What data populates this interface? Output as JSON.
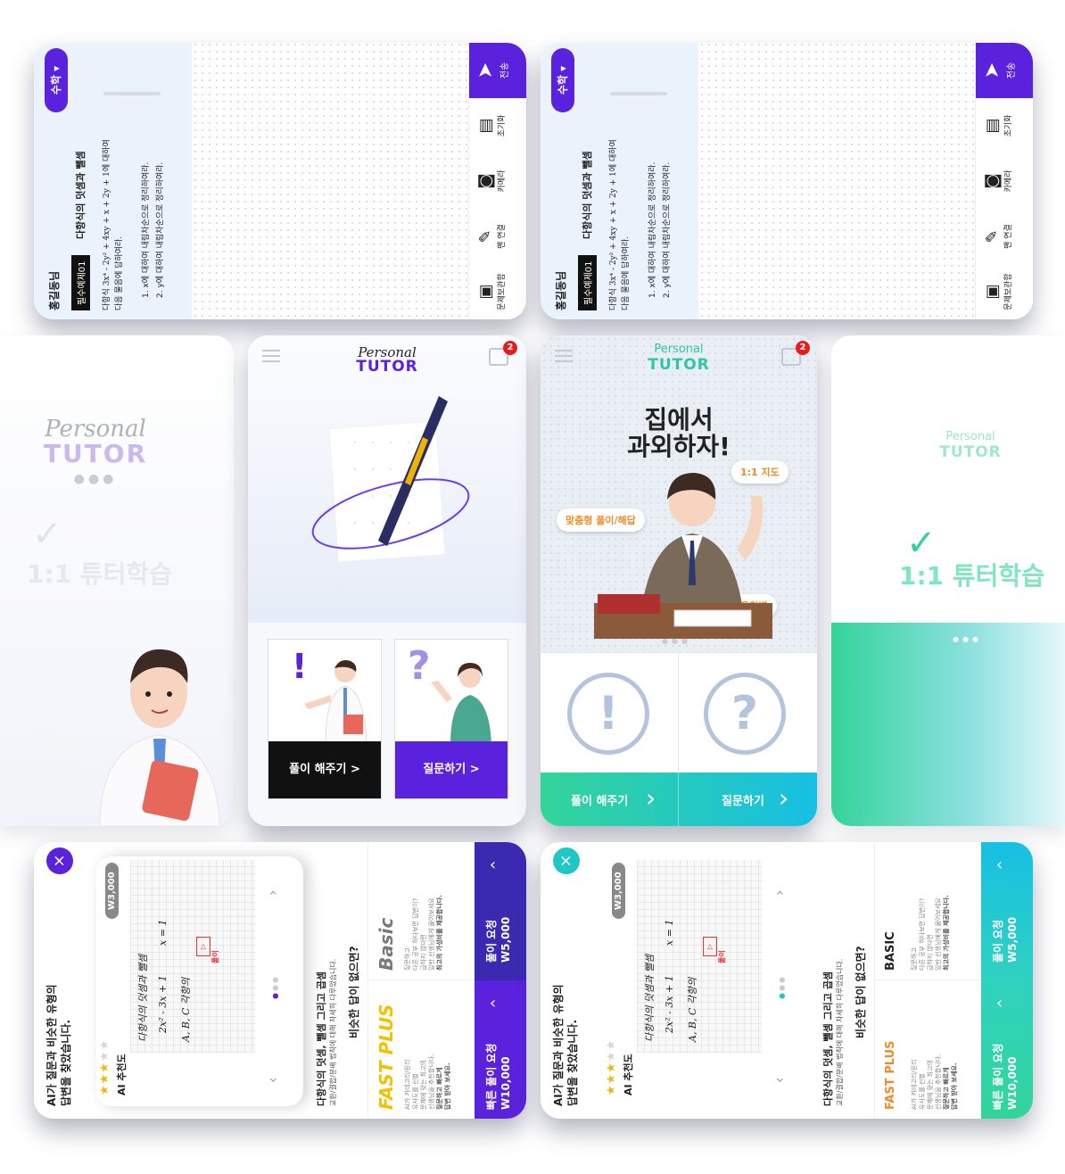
{
  "colors": {
    "purple": "#5a22dc",
    "teal": "#17bfe3",
    "green": "#33d49a",
    "navy": "#2a2d62",
    "orange": "#f0a030"
  },
  "problem_cards": {
    "user": "홍길동님",
    "subject": "수학",
    "badge": "필수예제01",
    "title": "다항식의 덧셈과 뺄셈",
    "line1": "다항식  3x⁴ - 2y² + 4xy + x + 2y + 1에 대하여",
    "line2": "다음 물음에 답하여라.",
    "q1": "1. x에 대하여 내림차순으로 정리하여라.",
    "q2": "2. y에 대하여 내림차순으로 정리하여라.",
    "tools": [
      "전송",
      "초기화",
      "카메라",
      "펜 연결",
      "문제보관함"
    ]
  },
  "splash1": {
    "brand1": "Personal",
    "brand2": "TUTOR",
    "check": "✓",
    "tagline": "1:1 튜터학습"
  },
  "home_purple": {
    "brand1": "Personal",
    "brand2": "TUTOR",
    "badge": "2",
    "solve": "풀이 해주기 >",
    "ask": "질문하기 >"
  },
  "home_teal": {
    "brand1": "Personal",
    "brand2": "TUTOR",
    "badge": "2",
    "hero1": "집에서",
    "hero2": "과외하자!",
    "bubble1": "1:1 지도",
    "bubble2": "맞춤형 풀이/해답",
    "bubble3": "과목별 유형별",
    "solve": "풀이 해주기",
    "ask": "질문하기",
    "excl": "!",
    "quest": "?"
  },
  "splash2": {
    "brand1": "Personal",
    "brand2": "TUTOR",
    "check": "✓",
    "tagline": "1:1 튜터학습"
  },
  "result_cards": {
    "header1": "AI가 질문과 비슷한 유형의",
    "header2": "답변을 찾았습니다.",
    "ai": "AI 추천도",
    "rating": "3 of 5",
    "price": "W3,000",
    "hw": [
      "다항식의  덧셈과  뺄셈",
      "2x² - 3x + 1",
      "x = 1",
      "A, B, C  각항의"
    ],
    "stamp": "풀이",
    "topic": "다항식의 덧셈, 뺄셈 그리고 곱셈",
    "topic_sub": "교환/결합/분배 법칙에 대해 자세히 다루었습니다.",
    "nosim": "비슷한 답이 없으면?",
    "basic": "Basic",
    "basic2": "BASIC",
    "basic_desc": [
      "질문하고",
      "다른 공부 하다보면 답변이?",
      "급하지 않다면",
      "일반 선생님에게 물어보세요",
      "최고의 가성비를 제공합니다."
    ],
    "fast": "FAST PLUS",
    "fast_desc": [
      "AI가 카테고리/원리",
      "유사도를 선별",
      "문제에 맞는 최고의",
      "선생님을 추천합니다.",
      "질문하고 빠르게",
      "답변 받아 보세요."
    ],
    "req1": "풀이 요청",
    "req1p": "W5,000",
    "req2": "빠른 풀이 요청",
    "req2p": "W10,000",
    "close": "×"
  }
}
